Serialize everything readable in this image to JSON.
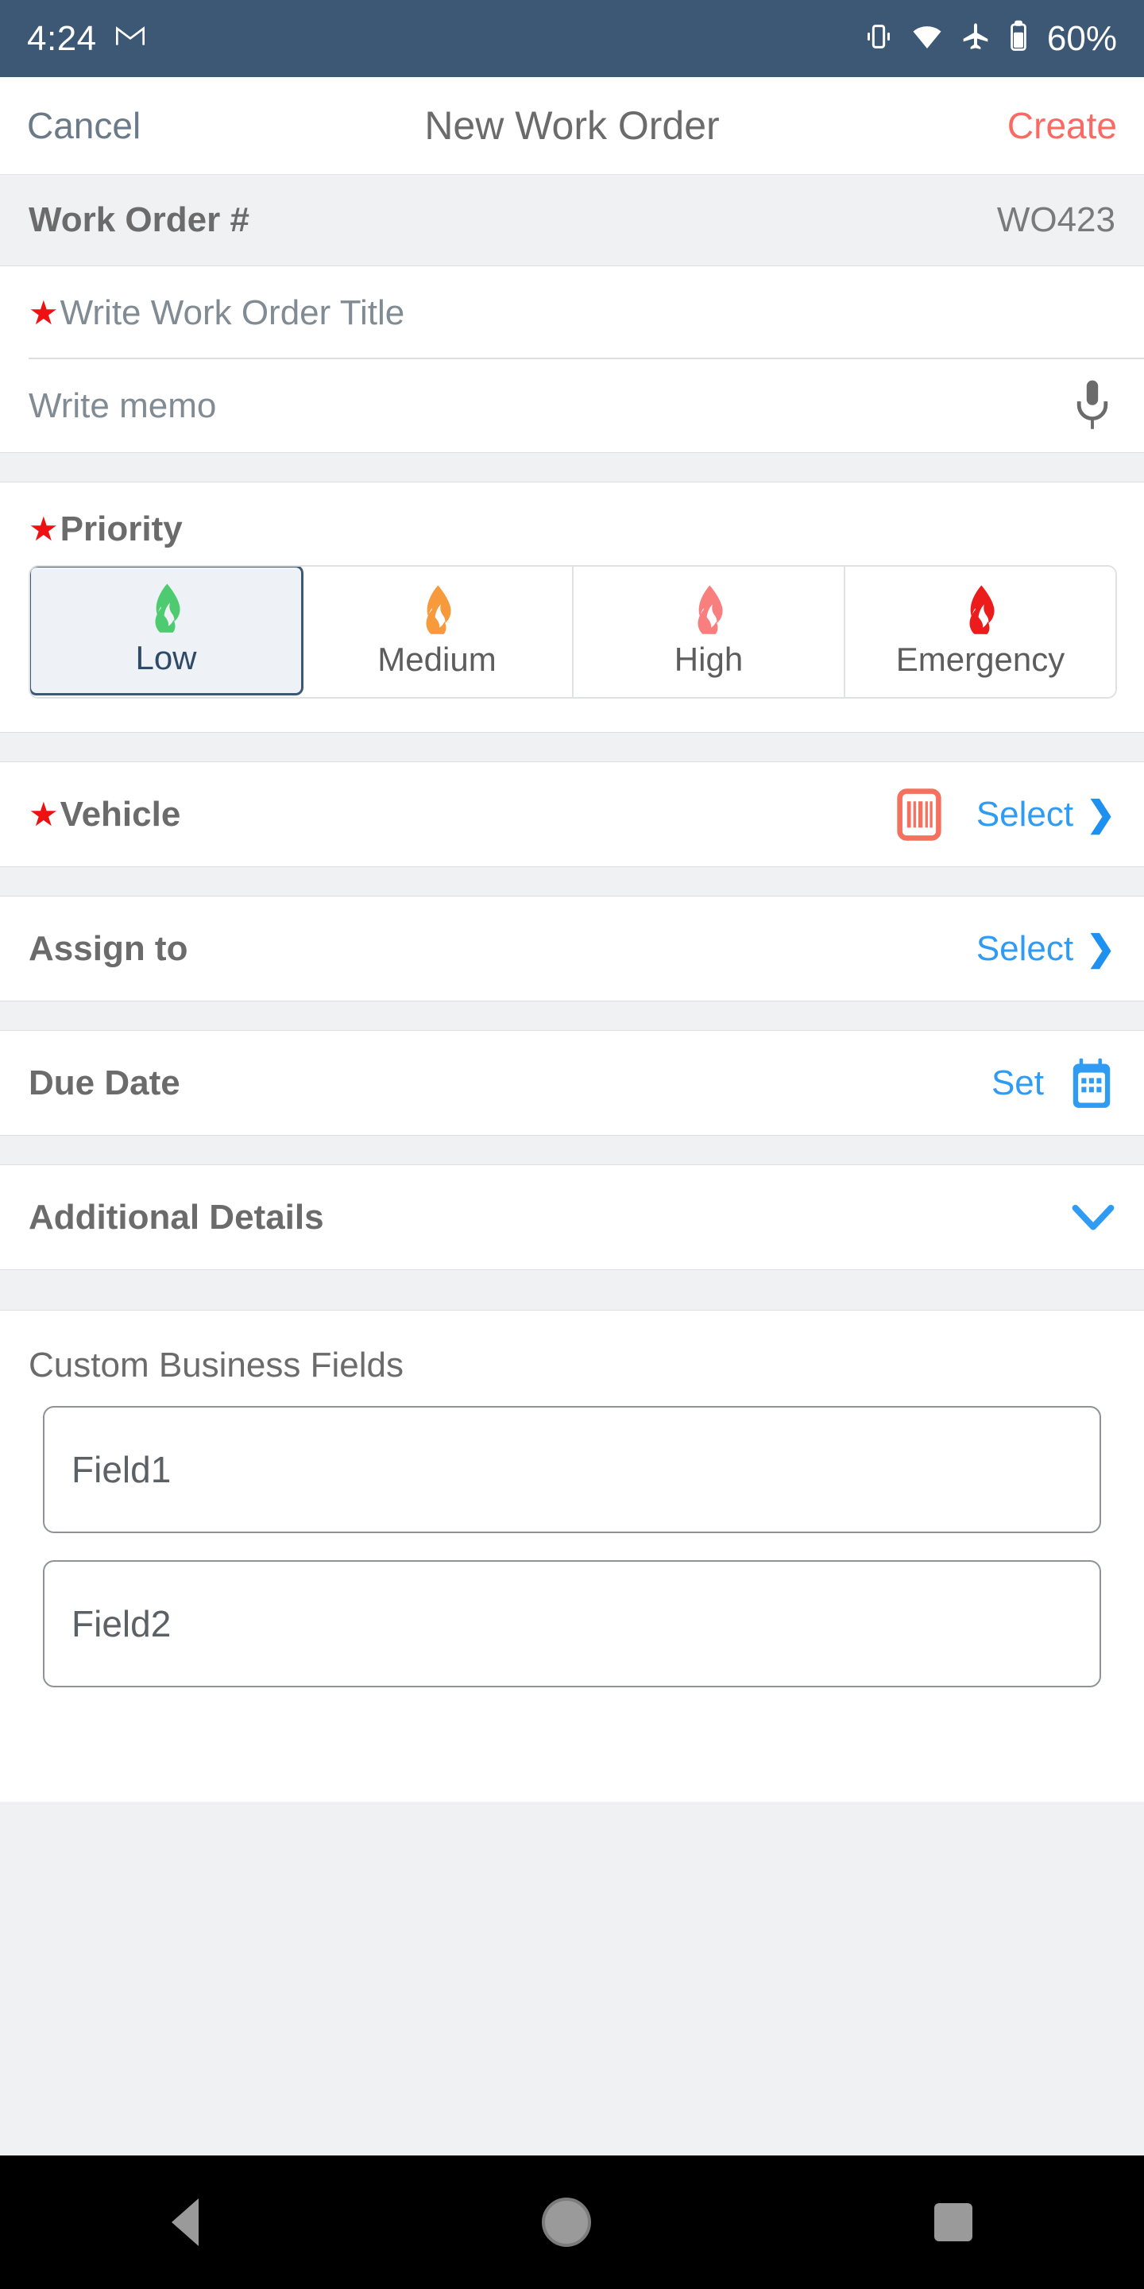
{
  "status_bar": {
    "time": "4:24",
    "gmail_icon": "gmail-icon",
    "vibrate_icon": "vibrate-icon",
    "wifi_icon": "wifi-icon",
    "airplane_icon": "airplane-mode-icon",
    "battery_icon": "battery-icon",
    "battery_text": "60%",
    "background": "#3d5874"
  },
  "nav_bar": {
    "cancel_label": "Cancel",
    "title": "New Work Order",
    "create_label": "Create",
    "create_color": "#fa6a63"
  },
  "form": {
    "work_order_number": {
      "label": "Work Order #",
      "value": "WO423"
    },
    "title_field": {
      "required_marker": "★",
      "placeholder": "Write Work Order Title",
      "value": ""
    },
    "memo_field": {
      "placeholder": "Write memo",
      "value": "",
      "mic_icon": "microphone-icon"
    },
    "priority": {
      "required_marker": "★",
      "label": "Priority",
      "selected": "Low",
      "options": [
        {
          "label": "Low",
          "flame_color": "#4ecb71",
          "selected": true
        },
        {
          "label": "Medium",
          "flame_color": "#f79a3c",
          "selected": false
        },
        {
          "label": "High",
          "flame_color": "#f97f7f",
          "selected": false
        },
        {
          "label": "Emergency",
          "flame_color": "#ec1c1c",
          "selected": false
        }
      ],
      "selected_border_color": "#3d5874",
      "selected_fill_color": "#eef1f5"
    },
    "vehicle": {
      "required_marker": "★",
      "label": "Vehicle",
      "barcode_icon": "barcode-scan-icon",
      "barcode_color": "#f4705f",
      "action_label": "Select",
      "chevron": "❯"
    },
    "assign_to": {
      "label": "Assign to",
      "action_label": "Select",
      "chevron": "❯"
    },
    "due_date": {
      "label": "Due Date",
      "action_label": "Set",
      "calendar_icon": "calendar-icon",
      "calendar_color": "#2f9bf2"
    },
    "additional_details": {
      "label": "Additional Details",
      "chevron_icon": "chevron-down-icon",
      "chevron_color": "#2f9bf2"
    },
    "custom_business_fields": {
      "section_label": "Custom Business Fields",
      "fields": [
        {
          "placeholder": "Field1",
          "value": ""
        },
        {
          "placeholder": "Field2",
          "value": ""
        }
      ]
    }
  },
  "android_nav": {
    "back": "back-button",
    "home": "home-button",
    "recents": "recents-button"
  }
}
